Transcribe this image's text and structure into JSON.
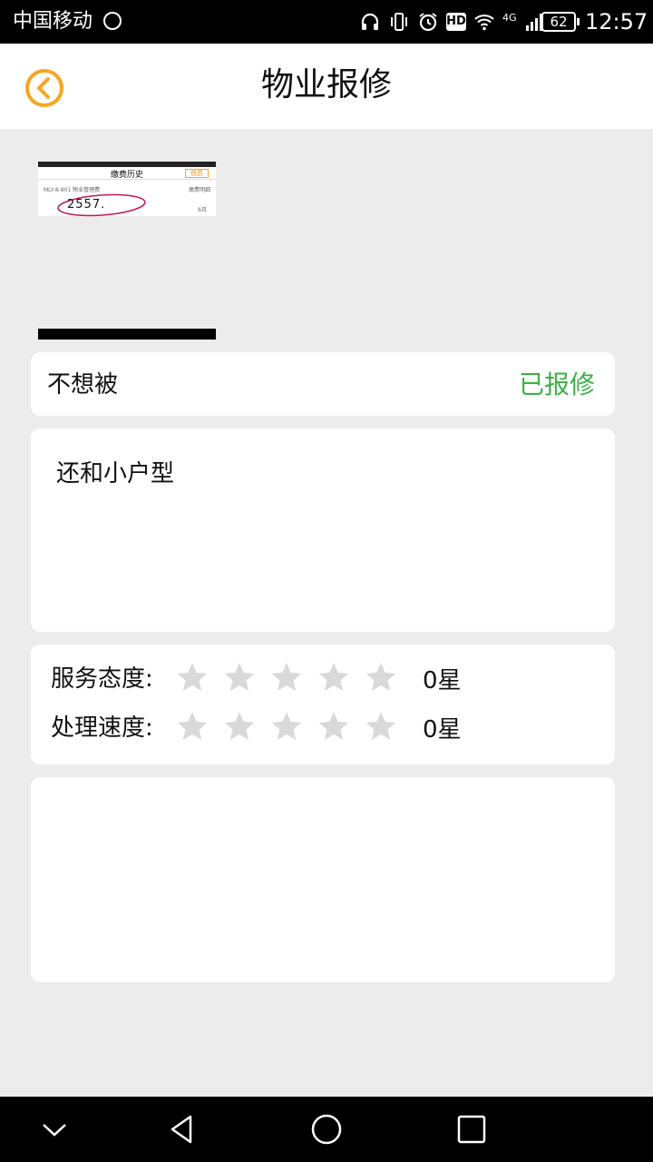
{
  "status_bar": {
    "carrier": "中国移动",
    "battery": "62",
    "network": "4G",
    "hd": "HD",
    "time": "12:57"
  },
  "header": {
    "title": "物业报修"
  },
  "attachment": {
    "preview_title": "缴费历史",
    "preview_button": "缴费",
    "preview_row_left": "MLY-8-801 物业管理费",
    "preview_row_right": "缴费明细",
    "preview_number": "2557.",
    "preview_month": "6月"
  },
  "repair": {
    "title": "不想被",
    "status": "已报修",
    "status_color": "#3bb143",
    "description": "还和小户型"
  },
  "rating": {
    "service_label": "服务态度:",
    "service_score": "0星",
    "service_stars": 0,
    "speed_label": "处理速度:",
    "speed_score": "0星",
    "speed_stars": 0,
    "max_stars": 5,
    "star_color": "#d9d9d9"
  },
  "colors": {
    "accent": "#f5a623",
    "background": "#ececec"
  }
}
